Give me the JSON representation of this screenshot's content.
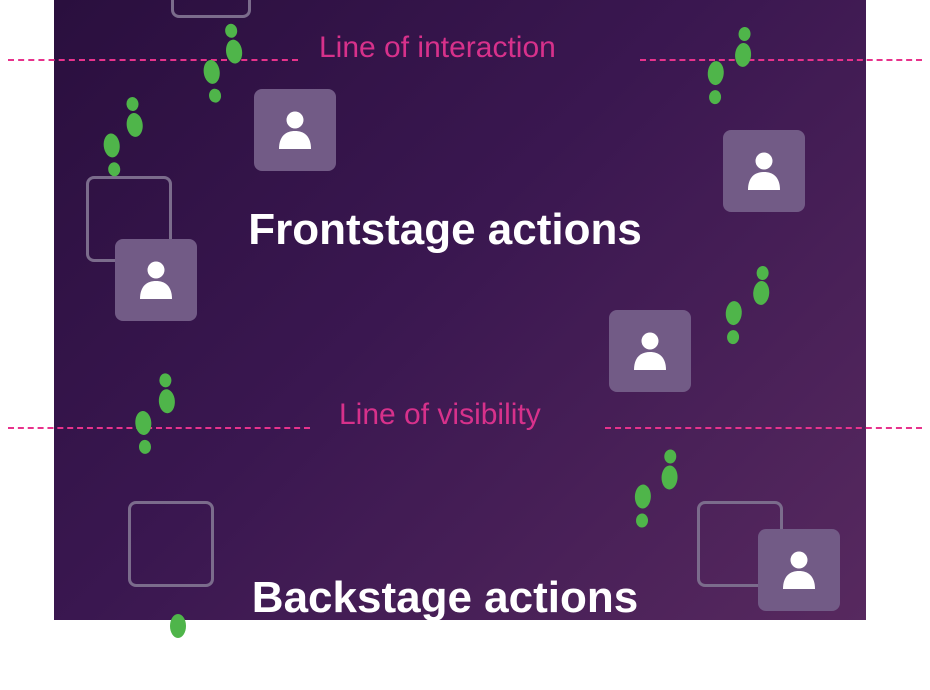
{
  "lines": {
    "interaction_label": "Line of interaction",
    "visibility_label": "Line of visibility"
  },
  "headings": {
    "frontstage": "Frontstage actions",
    "backstage": "Backstage actions"
  },
  "icons": {
    "person": "person-icon",
    "footprints": "footprints-icon"
  },
  "colors": {
    "panel_dark": "#2a0f3e",
    "panel_light": "#57295f",
    "line_magenta": "#e8328c",
    "footprint_green": "#4fb54a",
    "card_fill": "#725b86",
    "outline": "#7b6c8c"
  }
}
